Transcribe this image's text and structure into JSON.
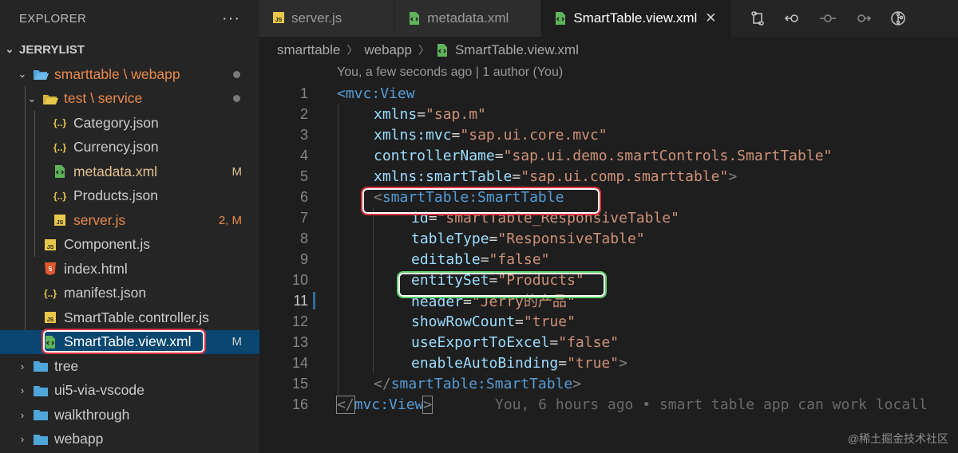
{
  "explorer": {
    "title": "EXPLORER",
    "more": "···",
    "section": "JERRYLIST",
    "tree": [
      {
        "label": "smarttable \\ webapp",
        "type": "folder-open",
        "level": 1,
        "status": "dot",
        "color": "orange"
      },
      {
        "label": "test \\ service",
        "type": "folder-open",
        "level": 2,
        "status": "dot",
        "color": "orange"
      },
      {
        "label": "Category.json",
        "type": "json",
        "level": 3
      },
      {
        "label": "Currency.json",
        "type": "json",
        "level": 3
      },
      {
        "label": "metadata.xml",
        "type": "xml",
        "level": 3,
        "badge": "M",
        "color": "mod"
      },
      {
        "label": "Products.json",
        "type": "json",
        "level": 3
      },
      {
        "label": "server.js",
        "type": "js",
        "level": 3,
        "badge": "2, M",
        "color": "orange"
      },
      {
        "label": "Component.js",
        "type": "js",
        "level": 2
      },
      {
        "label": "index.html",
        "type": "html",
        "level": 2
      },
      {
        "label": "manifest.json",
        "type": "json",
        "level": 2
      },
      {
        "label": "SmartTable.controller.js",
        "type": "js",
        "level": 2
      },
      {
        "label": "SmartTable.view.xml",
        "type": "xml",
        "level": 2,
        "badge": "M",
        "selected": true
      },
      {
        "label": "tree",
        "type": "folder",
        "level": 1
      },
      {
        "label": "ui5-via-vscode",
        "type": "folder",
        "level": 1
      },
      {
        "label": "walkthrough",
        "type": "folder",
        "level": 1
      },
      {
        "label": "webapp",
        "type": "folder",
        "level": 1
      }
    ]
  },
  "tabs": [
    {
      "label": "server.js",
      "icon": "js"
    },
    {
      "label": "metadata.xml",
      "icon": "xml"
    },
    {
      "label": "SmartTable.view.xml",
      "icon": "xml",
      "active": true,
      "close": "✕"
    }
  ],
  "breadcrumb": [
    "smarttable",
    "webapp",
    "SmartTable.view.xml"
  ],
  "blame_header": "You, a few seconds ago | 1 author (You)",
  "code": {
    "lines": [
      "1",
      "2",
      "3",
      "4",
      "5",
      "6",
      "7",
      "8",
      "9",
      "10",
      "11",
      "12",
      "13",
      "14",
      "15",
      "16"
    ],
    "l1_open": "<",
    "l1_tag": "mvc:View",
    "l2_attr": "xmlns",
    "l2_val": "\"sap.m\"",
    "l3_attr": "xmlns:mvc",
    "l3_val": "\"sap.ui.core.mvc\"",
    "l4_attr": "controllerName",
    "l4_val": "\"sap.ui.demo.smartControls.SmartTable\"",
    "l5_attr": "xmlns:smartTable",
    "l5_val": "\"sap.ui.comp.smarttable\"",
    "l5_close": ">",
    "l6_open": "<",
    "l6_tag": "smartTable:SmartTable",
    "l7_attr": "id",
    "l7_val": "\"smartTable_ResponsiveTable\"",
    "l8_attr": "tableType",
    "l8_val": "\"ResponsiveTable\"",
    "l9_attr": "editable",
    "l9_val": "\"false\"",
    "l10_attr": "entitySet",
    "l10_val": "\"Products\"",
    "l11_attr": "header",
    "l11_val": "\"Jerry的产品\"",
    "l12_attr": "showRowCount",
    "l12_val": "\"true\"",
    "l13_attr": "useExportToExcel",
    "l13_val": "\"false\"",
    "l14_attr": "enableAutoBinding",
    "l14_val": "\"true\"",
    "l14_close": ">",
    "l15_open": "</",
    "l15_tag": "smartTable:SmartTable",
    "l15_close": ">",
    "l16_open": "</",
    "l16_tag": "mvc:View",
    "l16_close": ">",
    "l16_blame": "You, 6 hours ago • smart table app can work locall",
    "eq": "="
  },
  "watermark": "@稀土掘金技术社区",
  "colors": {
    "accent": "#094771",
    "highlight_red": "#d9333f",
    "highlight_green": "#5fcf6a"
  }
}
